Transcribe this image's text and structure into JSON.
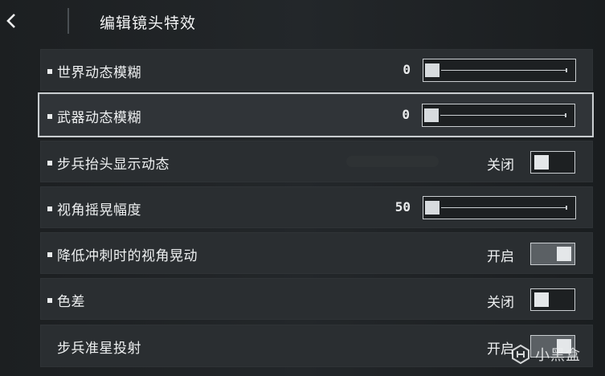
{
  "header": {
    "title": "编辑镜头特效"
  },
  "icons": {
    "back": "back-arrow-icon",
    "watermark": "xiaoheihe-logo-icon"
  },
  "colors": {
    "row_bg": "#2a2e31",
    "selected_border": "#c9cdd0",
    "text": "#eef0f1"
  },
  "settings": [
    {
      "label": "世界动态模糊",
      "type": "slider",
      "value": "0",
      "level": 0,
      "bullet": true
    },
    {
      "label": "武器动态模糊",
      "type": "slider",
      "value": "0",
      "level": 0,
      "bullet": true,
      "selected": true
    },
    {
      "label": "步兵抬头显示动态",
      "type": "toggle",
      "state_text": "关闭",
      "on": false,
      "bullet": true
    },
    {
      "label": "视角摇晃幅度",
      "type": "slider",
      "value": "50",
      "level": 0,
      "bullet": true
    },
    {
      "label": "降低冲刺时的视角晃动",
      "type": "toggle",
      "state_text": "开启",
      "on": true,
      "bullet": true
    },
    {
      "label": "色差",
      "type": "toggle",
      "state_text": "关闭",
      "on": false,
      "bullet": true
    },
    {
      "label": "步兵准星投射",
      "type": "toggle",
      "state_text": "开启",
      "on": true,
      "bullet": false
    }
  ],
  "watermark": {
    "text": "小黑盒"
  }
}
